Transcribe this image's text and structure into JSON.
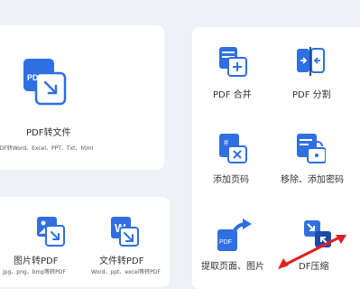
{
  "left_top": {
    "title": "PDF转文件",
    "subtitle": "PDF转Word、Excel、PPT、Txt、html",
    "icon_badge": "PDF"
  },
  "left_bottom": [
    {
      "title": "图片转PDF",
      "subtitle": "jpg、png、bmp等转PDF"
    },
    {
      "title": "文件转PDF",
      "subtitle": "Word、ppt、excel等转PDF",
      "icon_letter": "W"
    }
  ],
  "right_tools": [
    {
      "label": "PDF 合并"
    },
    {
      "label": "PDF 分割"
    },
    {
      "label": "添加页码"
    },
    {
      "label": "移除、添加密码"
    },
    {
      "label": "提取页面、图片"
    },
    {
      "label": "DF压缩"
    }
  ],
  "colors": {
    "background": "#eef2f6",
    "card": "#ffffff",
    "primary": "#2f6fe0",
    "accent_dark": "#1d4aa8",
    "annotation_red": "#e02020"
  }
}
